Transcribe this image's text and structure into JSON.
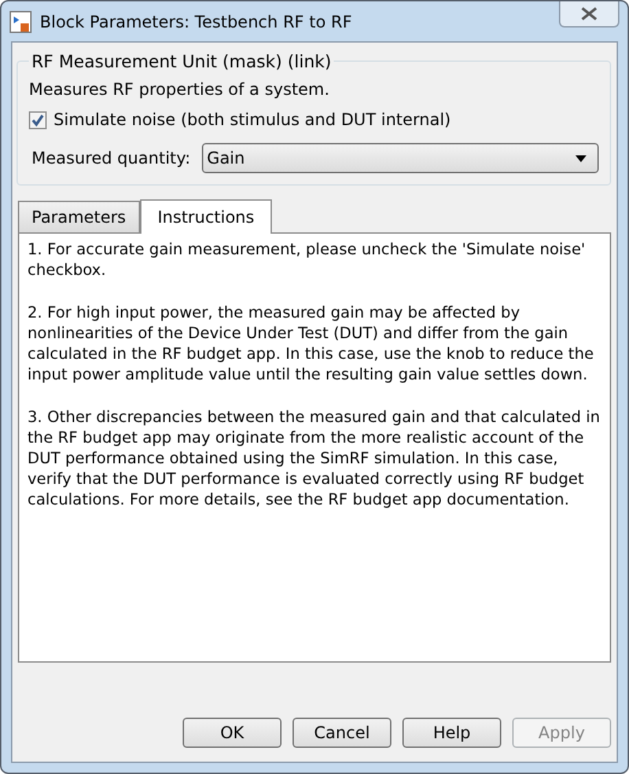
{
  "window": {
    "title": "Block Parameters: Testbench RF to RF"
  },
  "group": {
    "title": "RF Measurement Unit (mask) (link)",
    "description": "Measures RF properties of a system.",
    "checkbox": {
      "label": "Simulate noise (both stimulus and DUT internal)",
      "checked": true
    },
    "dropdown": {
      "label": "Measured quantity:",
      "value": "Gain"
    }
  },
  "tabs": [
    {
      "label": "Parameters",
      "selected": false
    },
    {
      "label": "Instructions",
      "selected": true
    }
  ],
  "instructions": [
    "1. For accurate gain measurement, please uncheck the 'Simulate noise' checkbox.",
    "2. For high input power, the measured gain may be affected by nonlinearities of the Device Under Test (DUT) and differ from the gain calculated in the RF budget app. In this case, use the knob to reduce the input power amplitude value until the resulting gain value settles down.",
    "3. Other discrepancies between the measured gain and that calculated in the RF budget app may originate from the more realistic account of the DUT performance obtained using the SimRF simulation. In this case, verify that the DUT performance is evaluated correctly using RF budget calculations. For more details, see the RF budget app documentation."
  ],
  "buttons": [
    {
      "label": "OK",
      "disabled": false
    },
    {
      "label": "Cancel",
      "disabled": false
    },
    {
      "label": "Help",
      "disabled": false
    },
    {
      "label": "Apply",
      "disabled": true
    }
  ]
}
